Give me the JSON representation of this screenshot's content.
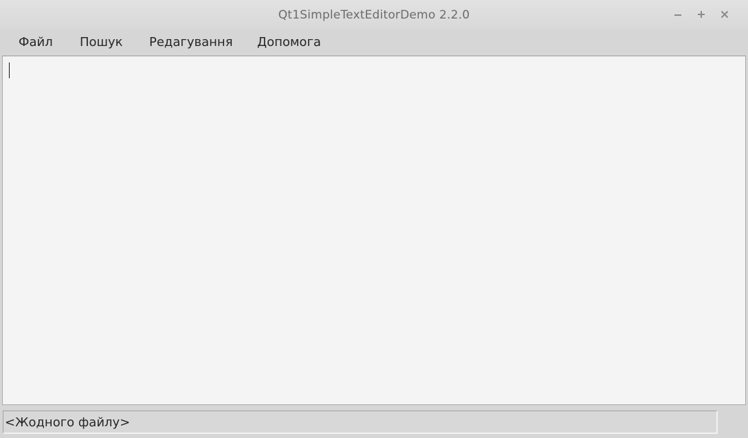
{
  "window": {
    "title": "Qt1SimpleTextEditorDemo 2.2.0",
    "controls": {
      "minimize_icon": "minimize-icon",
      "maximize_icon": "maximize-icon",
      "close_icon": "close-icon"
    }
  },
  "menubar": {
    "items": [
      {
        "label": "Файл"
      },
      {
        "label": "Пошук"
      },
      {
        "label": "Редагування"
      },
      {
        "label": "Допомога"
      }
    ]
  },
  "editor": {
    "content": ""
  },
  "statusbar": {
    "text": "<Жодного файлу>"
  },
  "colors": {
    "window_bg": "#d6d6d6",
    "editor_bg": "#f4f4f4",
    "title_text": "#6b6b6b",
    "menu_text": "#262626"
  }
}
